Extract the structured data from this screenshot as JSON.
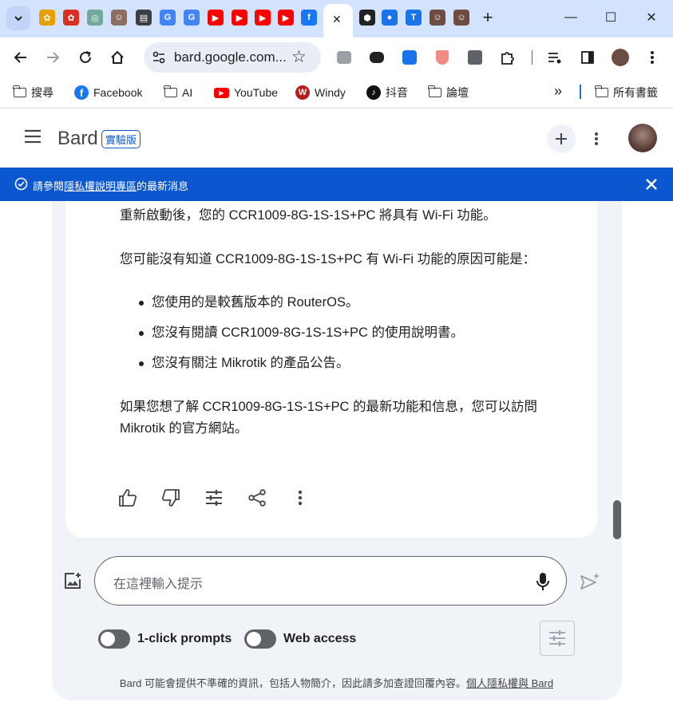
{
  "browser": {
    "tab_list_button_icon": "chevron-down-icon",
    "tab_favicons": [
      {
        "name": "mixed-icon-1",
        "color": "#e8a000",
        "glyph": "✿"
      },
      {
        "name": "mixed-icon-2",
        "color": "#d93025",
        "glyph": "✿"
      },
      {
        "name": "openai-icon",
        "color": "#74aa9c",
        "glyph": "◎"
      },
      {
        "name": "avatar-tab-icon",
        "color": "#8d6e63",
        "glyph": "☺"
      },
      {
        "name": "document-icon",
        "color": "#3c4043",
        "glyph": "▤"
      },
      {
        "name": "google-icon-1",
        "color": "#4285f4",
        "glyph": "G"
      },
      {
        "name": "google-icon-2",
        "color": "#4285f4",
        "glyph": "G"
      },
      {
        "name": "youtube-icon-1",
        "color": "#ff0000",
        "glyph": "▶"
      },
      {
        "name": "youtube-icon-2",
        "color": "#ff0000",
        "glyph": "▶"
      },
      {
        "name": "youtube-icon-3",
        "color": "#ff0000",
        "glyph": "▶"
      },
      {
        "name": "youtube-icon-4",
        "color": "#ff0000",
        "glyph": "▶"
      },
      {
        "name": "facebook-icon",
        "color": "#1877f2",
        "glyph": "f"
      }
    ],
    "active_tab_close_icon": "close-icon",
    "after_tabs_favicons": [
      {
        "name": "cube-icon",
        "color": "#202124",
        "glyph": "⬢"
      },
      {
        "name": "account-icon",
        "color": "#1a73e8",
        "glyph": "●"
      },
      {
        "name": "t-icon",
        "color": "#1a73e8",
        "glyph": "T"
      },
      {
        "name": "avatar-tab-icon-2",
        "color": "#6d4c41",
        "glyph": "☺"
      },
      {
        "name": "avatar-tab-icon-3",
        "color": "#6d4c41",
        "glyph": "☺"
      }
    ],
    "new_tab_glyph": "+",
    "window_controls": {
      "minimize": "—",
      "maximize": "☐",
      "close": "✕"
    },
    "address": "bard.google.com...",
    "bookmarks": [
      {
        "label": "搜尋",
        "icon": "folder-icon"
      },
      {
        "label": "Facebook",
        "icon": "facebook-icon"
      },
      {
        "label": "AI",
        "icon": "folder-icon"
      },
      {
        "label": "YouTube",
        "icon": "youtube-icon"
      },
      {
        "label": "Windy",
        "icon": "windy-icon"
      },
      {
        "label": "抖音",
        "icon": "tiktok-icon"
      },
      {
        "label": "論壇",
        "icon": "folder-icon"
      }
    ],
    "bookmarks_overflow": "»",
    "all_bookmarks_label": "所有書籤"
  },
  "app": {
    "name": "Bard",
    "badge": "實驗版",
    "banner": {
      "prefix": "請參閱",
      "link": "隱私權說明專區",
      "suffix": "的最新消息"
    }
  },
  "response": {
    "line1": "重新啟動後，您的 CCR1009-8G-1S-1S+PC 將具有 Wi-Fi 功能。",
    "line2": "您可能沒有知道 CCR1009-8G-1S-1S+PC 有 Wi-Fi 功能的原因可能是：",
    "bullets": [
      "您使用的是較舊版本的 RouterOS。",
      "您沒有閱讀 CCR1009-8G-1S-1S+PC 的使用說明書。",
      "您沒有關注 Mikrotik 的產品公告。"
    ],
    "closing_line1": "如果您想了解 CCR1009-8G-1S-1S+PC 的最新功能和信息，您可以訪問",
    "closing_line2": "Mikrotik 的官方網站。"
  },
  "input": {
    "placeholder": "在這裡輸入提示"
  },
  "toggles": [
    {
      "label": "1-click prompts",
      "state": "off"
    },
    {
      "label": "Web access",
      "state": "off"
    }
  ],
  "disclaimer": {
    "text": "Bard 可能會提供不準確的資訊，包括人物簡介，因此請多加查證回覆內容。",
    "link": "個人隱私權與 Bard"
  }
}
